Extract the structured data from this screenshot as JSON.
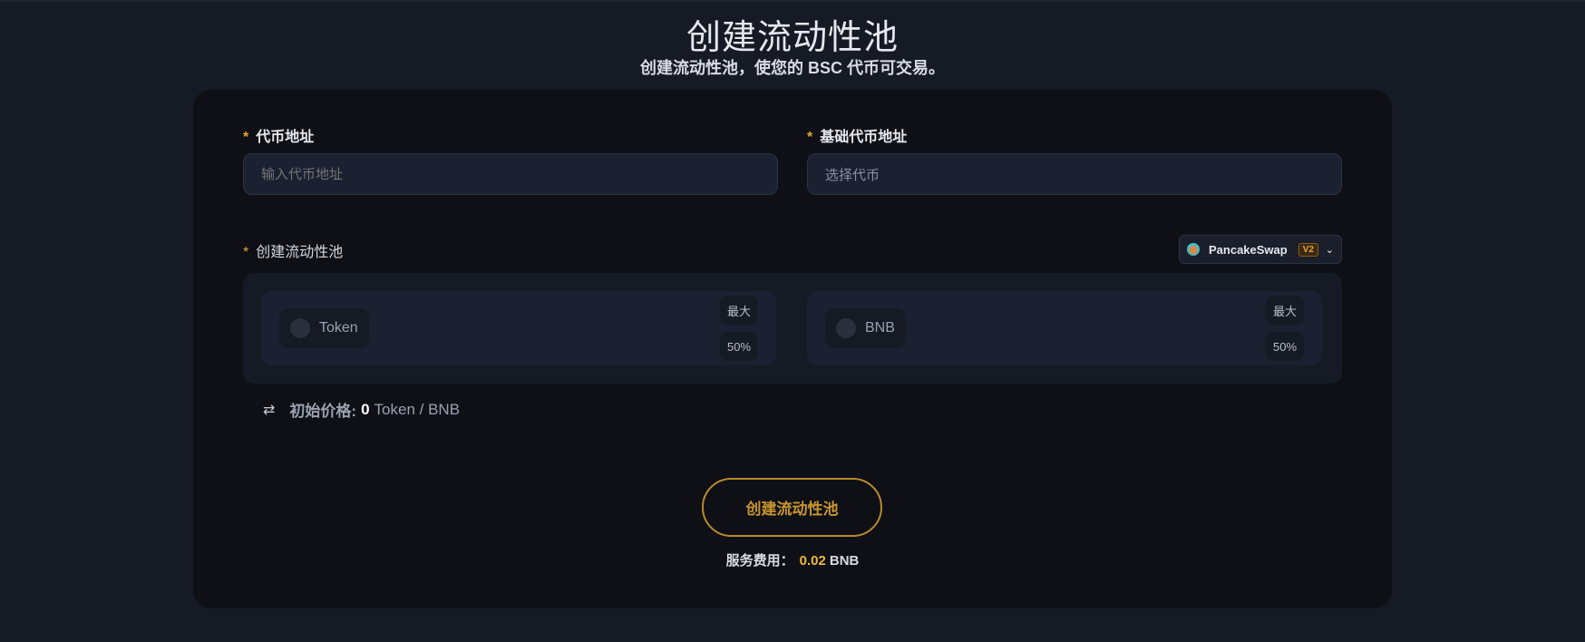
{
  "header": {
    "title": "创建流动性池",
    "subtitle": "创建流动性池，使您的 BSC 代币可交易。"
  },
  "form": {
    "token_address": {
      "required_mark": "*",
      "label": "代币地址",
      "placeholder": "输入代币地址"
    },
    "base_token_address": {
      "required_mark": "*",
      "label": "基础代币地址",
      "placeholder": "选择代币"
    },
    "pool": {
      "required_mark": "*",
      "label": "创建流动性池",
      "dex": {
        "name": "PancakeSwap",
        "version": "V2",
        "icon": "pancakeswap-logo-icon"
      },
      "panels": [
        {
          "token": "Token",
          "max_label": "最大",
          "half_label": "50%"
        },
        {
          "token": "BNB",
          "max_label": "最大",
          "half_label": "50%"
        }
      ]
    },
    "initial_price": {
      "icon": "swap-arrows-icon",
      "label": "初始价格:",
      "value": "0",
      "unit": "Token / BNB"
    }
  },
  "actions": {
    "create_label": "创建流动性池"
  },
  "fee": {
    "label": "服务费用：",
    "amount": "0.02",
    "unit": "BNB"
  },
  "colors": {
    "background": "#161a24",
    "card": "#0e1016",
    "accent": "#e9a23b",
    "button_border": "#b98a2c",
    "fee_amount": "#f0b93a"
  }
}
